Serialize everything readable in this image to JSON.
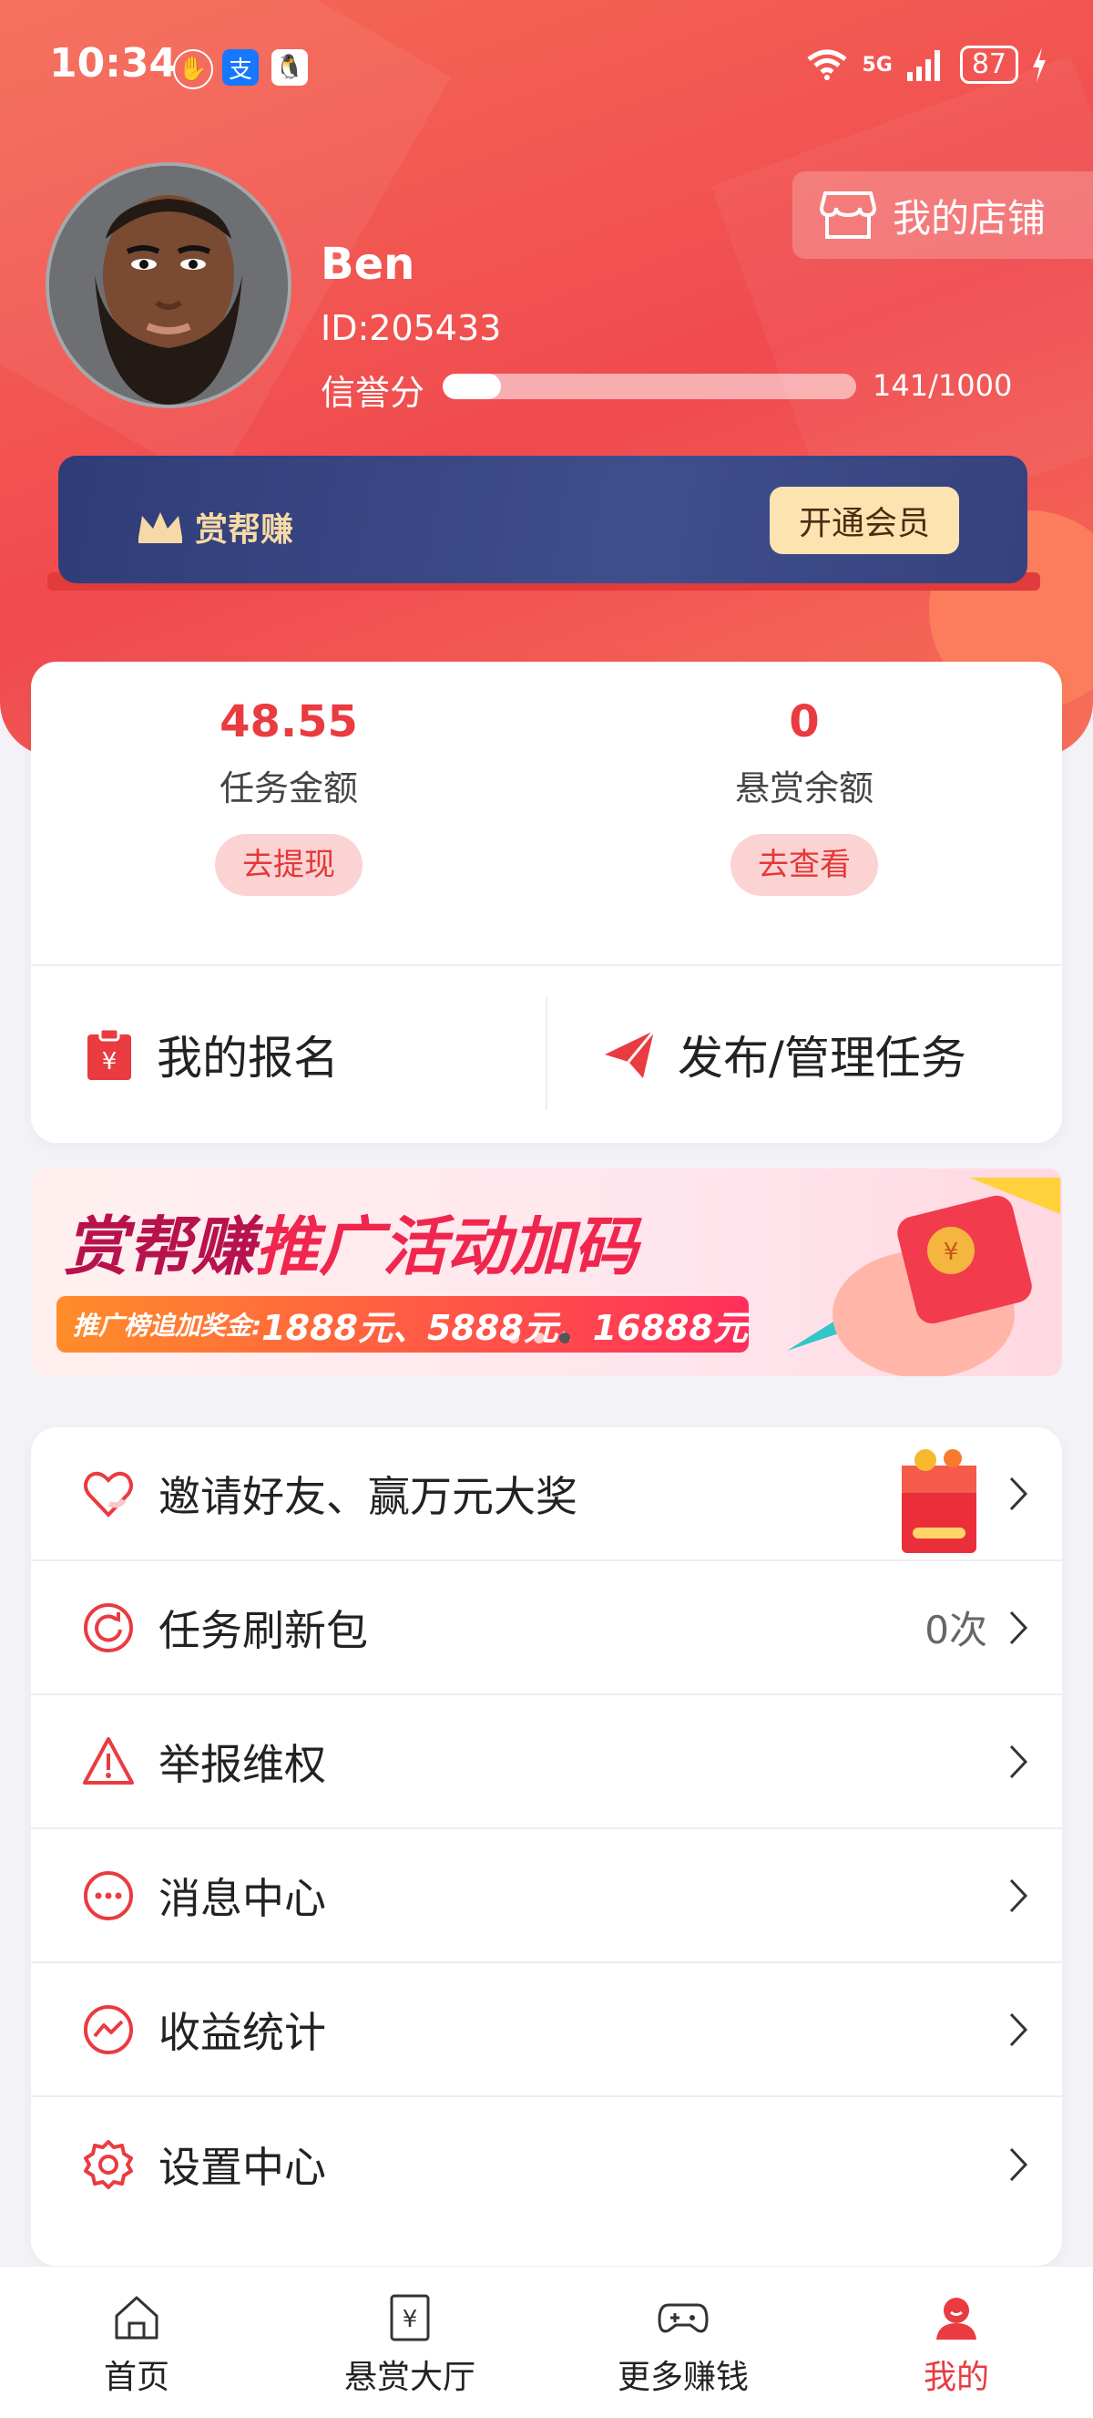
{
  "status": {
    "time": "10:34",
    "battery": "87",
    "network": "5G"
  },
  "profile": {
    "name": "Ben",
    "id_label": "ID:205433",
    "credit_label": "信誉分",
    "credit_value": "141/1000",
    "credit_fraction": 0.141
  },
  "shop": {
    "label": "我的店铺"
  },
  "vip": {
    "title": "赏帮赚",
    "button": "开通会员"
  },
  "stats": [
    {
      "value": "48.55",
      "label": "任务金额",
      "button": "去提现"
    },
    {
      "value": "0",
      "label": "悬赏余额",
      "button": "去查看"
    }
  ],
  "actions": {
    "signup": "我的报名",
    "publish": "发布/管理任务"
  },
  "banner": {
    "title_part1": "赏帮赚",
    "title_part2": "推广活动加码",
    "sub_label": "推广榜追加奖金:",
    "sub_amounts": "1888元、5888元、16888元"
  },
  "menu": [
    {
      "label": "邀请好友、赢万元大奖",
      "value": "",
      "icon": "heart-icon"
    },
    {
      "label": "任务刷新包",
      "value": "0次",
      "icon": "refresh-icon"
    },
    {
      "label": "举报维权",
      "value": "",
      "icon": "warning-icon"
    },
    {
      "label": "消息中心",
      "value": "",
      "icon": "message-icon"
    },
    {
      "label": "收益统计",
      "value": "",
      "icon": "chart-icon"
    },
    {
      "label": "设置中心",
      "value": "",
      "icon": "gear-icon"
    }
  ],
  "tabs": [
    {
      "label": "首页",
      "icon": "home-icon"
    },
    {
      "label": "悬赏大厅",
      "icon": "reward-hall-icon"
    },
    {
      "label": "更多赚钱",
      "icon": "gamepad-icon"
    },
    {
      "label": "我的",
      "icon": "profile-icon"
    }
  ],
  "colors": {
    "accent": "#ea3b40",
    "hero": "#f04a4f",
    "vip_bg": "#3f4f8c",
    "vip_gold": "#f6d9a6"
  }
}
